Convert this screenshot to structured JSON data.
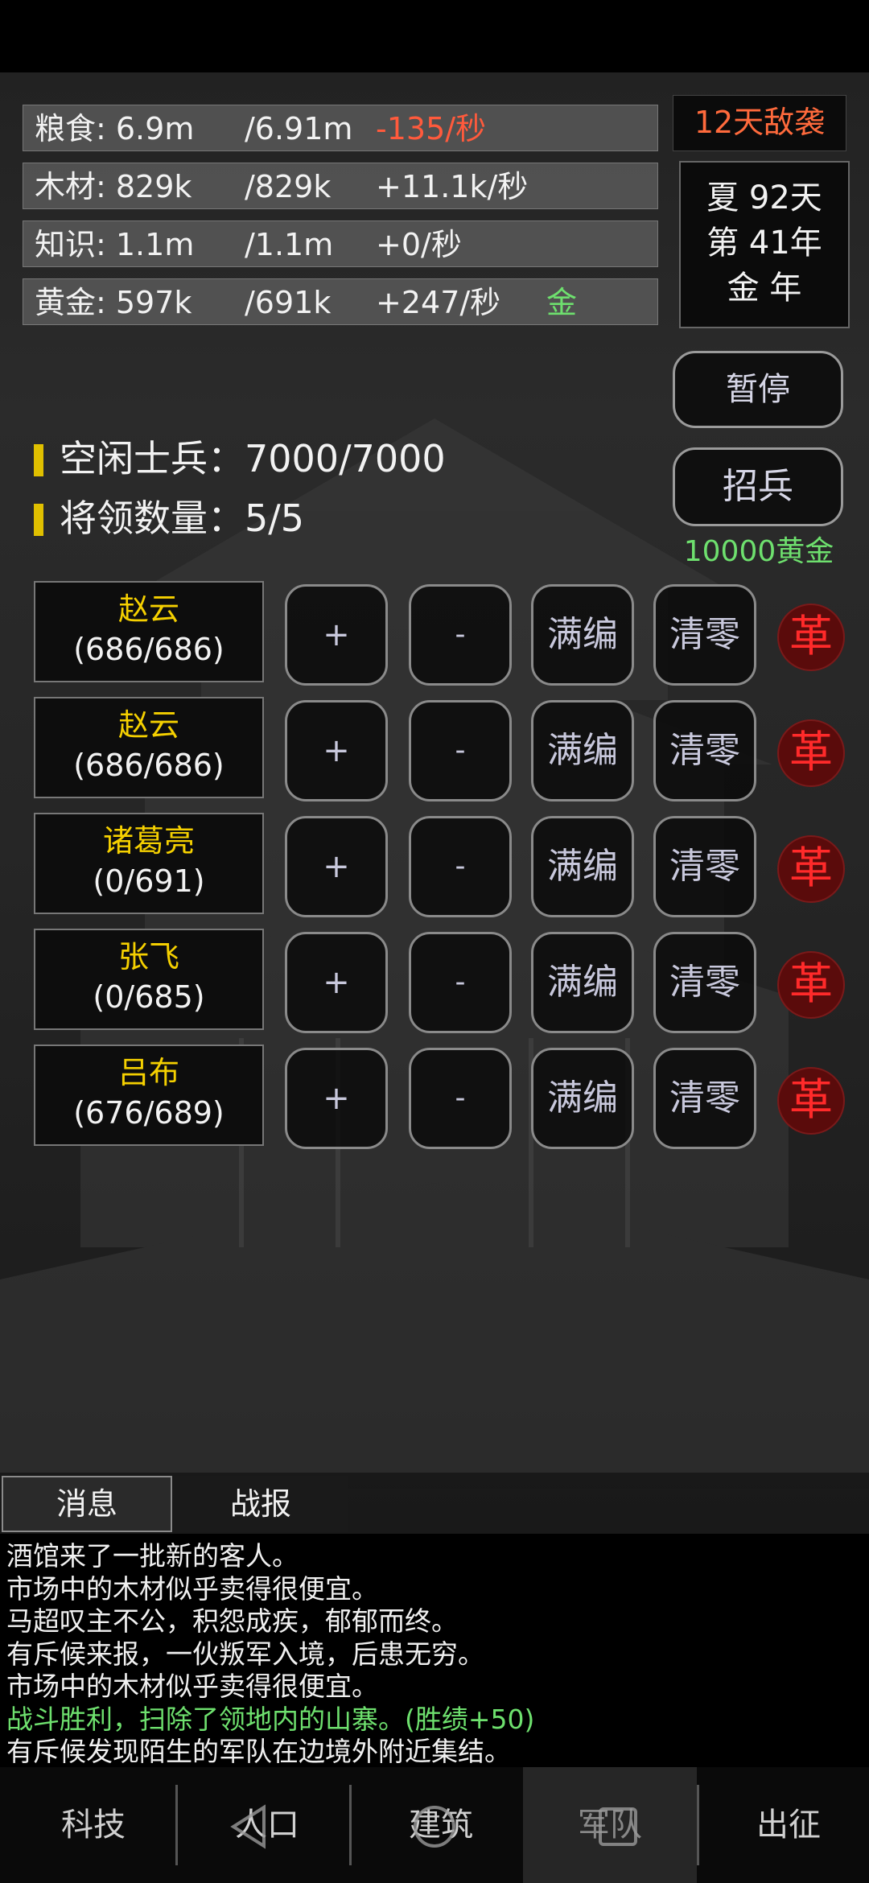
{
  "resources": [
    {
      "name": "粮食: 6.9m",
      "max": "/6.91m",
      "rate": "-135/秒",
      "tag": ""
    },
    {
      "name": "木材: 829k",
      "max": "/829k",
      "rate": "+11.1k/秒",
      "tag": ""
    },
    {
      "name": "知识: 1.1m",
      "max": "/1.1m",
      "rate": "+0/秒",
      "tag": ""
    },
    {
      "name": "黄金: 597k",
      "max": "/691k",
      "rate": "+247/秒",
      "tag": "金"
    }
  ],
  "enemy_warning": "12天敌袭",
  "date": {
    "season_day": "夏 92天",
    "year": "第 41年",
    "element_year": "金 年"
  },
  "pause_label": "暂停",
  "recruit_label": "招兵",
  "recruit_cost": "10000黄金",
  "idle_soldiers": "空闲士兵：7000/7000",
  "general_count": "将领数量：5/5",
  "generals": [
    {
      "name": "赵云",
      "count": "(686/686)"
    },
    {
      "name": "赵云",
      "count": "(686/686)"
    },
    {
      "name": "诸葛亮",
      "count": "(0/691)"
    },
    {
      "name": "张飞",
      "count": "(0/685)"
    },
    {
      "name": "吕布",
      "count": "(676/689)"
    }
  ],
  "row_buttons": {
    "plus": "+",
    "minus": "-",
    "full": "满编",
    "clear": "清零",
    "revolt": "革"
  },
  "tabs": [
    "消息",
    "战报"
  ],
  "log": [
    {
      "text": "酒馆来了一批新的客人。",
      "highlight": false
    },
    {
      "text": "市场中的木材似乎卖得很便宜。",
      "highlight": false
    },
    {
      "text": "马超叹主不公，积怨成疾，郁郁而终。",
      "highlight": false
    },
    {
      "text": "有斥候来报，一伙叛军入境，后患无穷。",
      "highlight": false
    },
    {
      "text": "市场中的木材似乎卖得很便宜。",
      "highlight": false
    },
    {
      "text": "战斗胜利，扫除了领地内的山寨。(胜绩+50)",
      "highlight": true
    },
    {
      "text": "有斥候发现陌生的军队在边境外附近集结。",
      "highlight": false
    }
  ],
  "bottom_nav": [
    "科技",
    "人口",
    "建筑",
    "军队",
    "出征"
  ],
  "colors": {
    "warning": "#ff6a3c",
    "green": "#6ee06e",
    "gold": "#f5d000",
    "revolt": "#ff2a2a"
  }
}
